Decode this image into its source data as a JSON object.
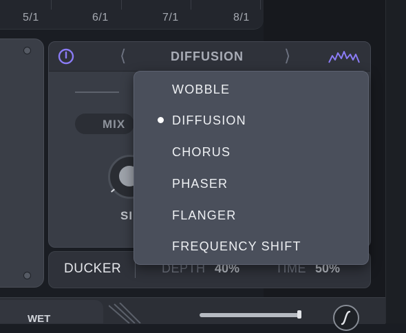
{
  "timeline": {
    "labels": [
      "5/1",
      "6/1",
      "7/1",
      "8/1"
    ]
  },
  "effect": {
    "title": "DIFFUSION",
    "prev_icon": "chevron-left-icon",
    "next_icon": "chevron-right-icon",
    "power_icon": "power-icon",
    "wave_icon": "waveform-icon",
    "mix_label": "MIX",
    "size_label": "SI",
    "accent_color": "#7b6cf0"
  },
  "dropdown": {
    "items": [
      {
        "label": "WOBBLE",
        "selected": false
      },
      {
        "label": "DIFFUSION",
        "selected": true
      },
      {
        "label": "CHORUS",
        "selected": false
      },
      {
        "label": "PHASER",
        "selected": false
      },
      {
        "label": "FLANGER",
        "selected": false
      },
      {
        "label": "FREQUENCY SHIFT",
        "selected": false
      }
    ]
  },
  "ducker": {
    "label": "DUCKER",
    "depth_label": "DEPTH",
    "depth_value": "40%",
    "time_label": "TIME",
    "time_value": "50%"
  },
  "bottom": {
    "wet_label": "WET"
  }
}
